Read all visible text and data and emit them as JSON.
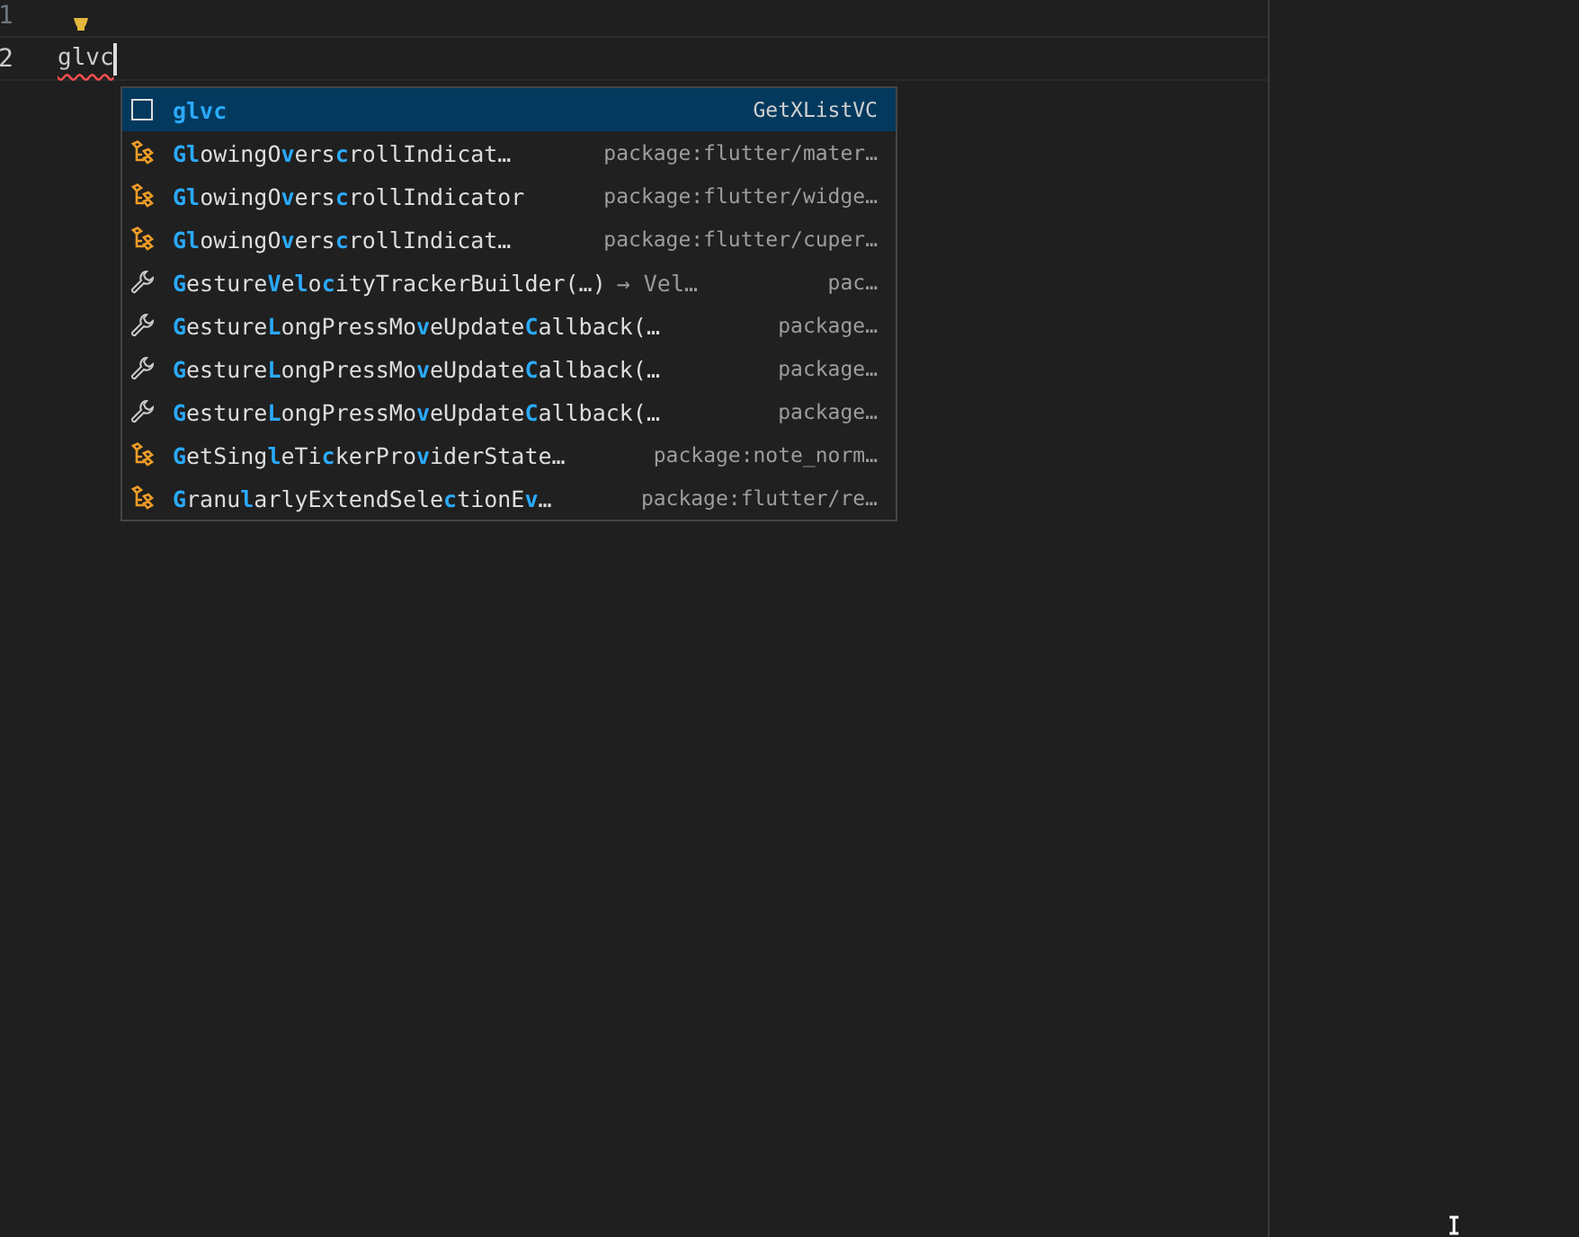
{
  "editor": {
    "lines": [
      {
        "number": "1",
        "lightbulb": true,
        "current": false
      },
      {
        "number": "2",
        "text": "glvc",
        "lightbulb": false,
        "current": true
      }
    ]
  },
  "suggestions": [
    {
      "kind": "snippet",
      "selected": true,
      "label": [
        {
          "text": "glvc",
          "match": true
        }
      ],
      "detail": "GetXListVC"
    },
    {
      "kind": "class",
      "selected": false,
      "label": [
        {
          "text": "Gl",
          "match": true
        },
        {
          "text": "owingO",
          "match": false
        },
        {
          "text": "v",
          "match": true
        },
        {
          "text": "ers",
          "match": false
        },
        {
          "text": "c",
          "match": true
        },
        {
          "text": "rollIndicat…",
          "match": false
        }
      ],
      "detail": "package:flutter/mater…"
    },
    {
      "kind": "class",
      "selected": false,
      "label": [
        {
          "text": "Gl",
          "match": true
        },
        {
          "text": "owingO",
          "match": false
        },
        {
          "text": "v",
          "match": true
        },
        {
          "text": "ers",
          "match": false
        },
        {
          "text": "c",
          "match": true
        },
        {
          "text": "rollIndicator",
          "match": false
        }
      ],
      "detail": "package:flutter/widge…"
    },
    {
      "kind": "class",
      "selected": false,
      "label": [
        {
          "text": "Gl",
          "match": true
        },
        {
          "text": "owingO",
          "match": false
        },
        {
          "text": "v",
          "match": true
        },
        {
          "text": "ers",
          "match": false
        },
        {
          "text": "c",
          "match": true
        },
        {
          "text": "rollIndicat…",
          "match": false
        }
      ],
      "detail": "package:flutter/cuper…"
    },
    {
      "kind": "function",
      "selected": false,
      "label": [
        {
          "text": "G",
          "match": true
        },
        {
          "text": "esture",
          "match": false
        },
        {
          "text": "V",
          "match": true
        },
        {
          "text": "e",
          "match": false
        },
        {
          "text": "l",
          "match": true
        },
        {
          "text": "o",
          "match": false
        },
        {
          "text": "c",
          "match": true
        },
        {
          "text": "ityTrackerBuilder(…)",
          "match": false
        }
      ],
      "signature": "→ Vel…",
      "detail": "pac…"
    },
    {
      "kind": "function",
      "selected": false,
      "label": [
        {
          "text": "G",
          "match": true
        },
        {
          "text": "esture",
          "match": false
        },
        {
          "text": "L",
          "match": true
        },
        {
          "text": "ongPressMo",
          "match": false
        },
        {
          "text": "v",
          "match": true
        },
        {
          "text": "eUpdate",
          "match": false
        },
        {
          "text": "C",
          "match": true
        },
        {
          "text": "allback(…",
          "match": false
        }
      ],
      "detail": "package…"
    },
    {
      "kind": "function",
      "selected": false,
      "label": [
        {
          "text": "G",
          "match": true
        },
        {
          "text": "esture",
          "match": false
        },
        {
          "text": "L",
          "match": true
        },
        {
          "text": "ongPressMo",
          "match": false
        },
        {
          "text": "v",
          "match": true
        },
        {
          "text": "eUpdate",
          "match": false
        },
        {
          "text": "C",
          "match": true
        },
        {
          "text": "allback(…",
          "match": false
        }
      ],
      "detail": "package…"
    },
    {
      "kind": "function",
      "selected": false,
      "label": [
        {
          "text": "G",
          "match": true
        },
        {
          "text": "esture",
          "match": false
        },
        {
          "text": "L",
          "match": true
        },
        {
          "text": "ongPressMo",
          "match": false
        },
        {
          "text": "v",
          "match": true
        },
        {
          "text": "eUpdate",
          "match": false
        },
        {
          "text": "C",
          "match": true
        },
        {
          "text": "allback(…",
          "match": false
        }
      ],
      "detail": "package…"
    },
    {
      "kind": "class",
      "selected": false,
      "label": [
        {
          "text": "G",
          "match": true
        },
        {
          "text": "etSing",
          "match": false
        },
        {
          "text": "l",
          "match": true
        },
        {
          "text": "eTi",
          "match": false
        },
        {
          "text": "c",
          "match": true
        },
        {
          "text": "kerPro",
          "match": false
        },
        {
          "text": "v",
          "match": true
        },
        {
          "text": "iderState…",
          "match": false
        }
      ],
      "detail": "package:note_norm…"
    },
    {
      "kind": "class",
      "selected": false,
      "label": [
        {
          "text": "G",
          "match": true
        },
        {
          "text": "ranu",
          "match": false
        },
        {
          "text": "l",
          "match": true
        },
        {
          "text": "arlyExtendSele",
          "match": false
        },
        {
          "text": "c",
          "match": true
        },
        {
          "text": "tionE",
          "match": false
        },
        {
          "text": "v",
          "match": true
        },
        {
          "text": "…",
          "match": false
        }
      ],
      "detail": "package:flutter/re…"
    }
  ]
}
